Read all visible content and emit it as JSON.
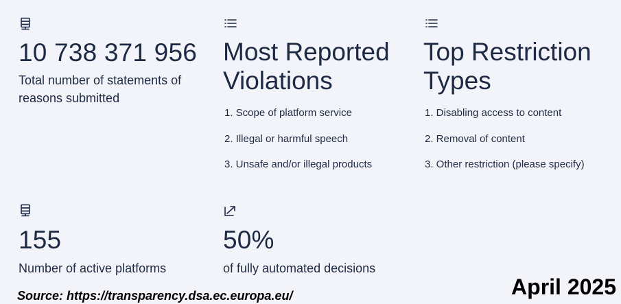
{
  "stats": {
    "statements": {
      "icon": "server-icon",
      "value": "10 738 371 956",
      "label": "Total number of statements of reasons submitted"
    },
    "violations": {
      "icon": "list-icon",
      "title": "Most Reported Violations",
      "items": [
        "1. Scope of platform service",
        "2. Illegal or harmful speech",
        "3. Unsafe and/or illegal products"
      ]
    },
    "restrictions": {
      "icon": "list-icon",
      "title": "Top Restriction Types",
      "items": [
        "1. Disabling access to content",
        "2. Removal of content",
        "3. Other restriction (please specify)"
      ]
    },
    "platforms": {
      "icon": "server-icon",
      "value": "155",
      "label": "Number of active platforms"
    },
    "automation": {
      "icon": "trend-arrow-icon",
      "value": "50%",
      "label": "of fully automated decisions"
    }
  },
  "footer": {
    "source": "Source: https://transparency.dsa.ec.europa.eu/",
    "date": "April 2025"
  },
  "colors": {
    "background": "#f3f4f9",
    "text": "#1e2a44",
    "footer_text": "#000000"
  }
}
